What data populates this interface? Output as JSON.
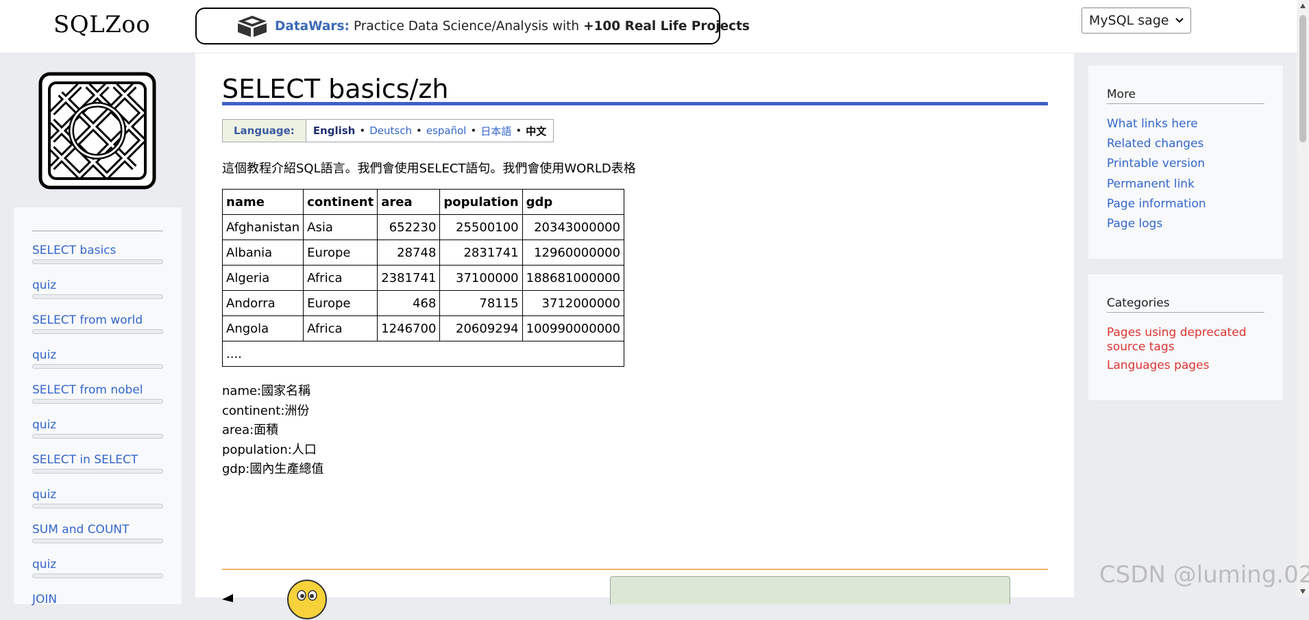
{
  "header": {
    "site_title": "SQLZoo",
    "banner": {
      "brand": "DataWars:",
      "text": "Practice Data Science/Analysis with",
      "bold": "+100 Real Life Projects"
    },
    "engine_select": {
      "value": "MySQL sage"
    }
  },
  "left_nav": {
    "items": [
      {
        "label": "SELECT basics"
      },
      {
        "label": "quiz"
      },
      {
        "label": "SELECT from world"
      },
      {
        "label": "quiz"
      },
      {
        "label": "SELECT from nobel"
      },
      {
        "label": "quiz"
      },
      {
        "label": "SELECT in SELECT"
      },
      {
        "label": "quiz"
      },
      {
        "label": "SUM and COUNT"
      },
      {
        "label": "quiz"
      },
      {
        "label": "JOIN"
      }
    ]
  },
  "main": {
    "title": "SELECT basics/zh",
    "language": {
      "label": "Language:",
      "english": "English",
      "deutsch": "Deutsch",
      "espanol": "español",
      "japanese": "日本語",
      "chinese": "中文",
      "separator": "•"
    },
    "intro": "這個教程介紹SQL語言。我們會使用SELECT語句。我們會使用WORLD表格",
    "table": {
      "headers": [
        "name",
        "continent",
        "area",
        "population",
        "gdp"
      ],
      "rows": [
        [
          "Afghanistan",
          "Asia",
          "652230",
          "25500100",
          "20343000000"
        ],
        [
          "Albania",
          "Europe",
          "28748",
          "2831741",
          "12960000000"
        ],
        [
          "Algeria",
          "Africa",
          "2381741",
          "37100000",
          "188681000000"
        ],
        [
          "Andorra",
          "Europe",
          "468",
          "78115",
          "3712000000"
        ],
        [
          "Angola",
          "Africa",
          "1246700",
          "20609294",
          "100990000000"
        ]
      ],
      "ellipsis": "...."
    },
    "fields": [
      "name:國家名稱",
      "continent:洲份",
      "area:面積",
      "population:人口",
      "gdp:國內生產總值"
    ]
  },
  "right_sidebar": {
    "more": {
      "heading": "More",
      "links": [
        "What links here",
        "Related changes",
        "Printable version",
        "Permanent link",
        "Page information",
        "Page logs"
      ]
    },
    "categories": {
      "heading": "Categories",
      "links": [
        "Pages using deprecated source tags",
        "Languages pages"
      ]
    }
  },
  "watermark": "CSDN @luming.02",
  "colors": {
    "link": "#3366cc",
    "category_link": "#d33333",
    "title_rule": "#3f5fc5",
    "bottom_rule": "#f0b06a"
  }
}
